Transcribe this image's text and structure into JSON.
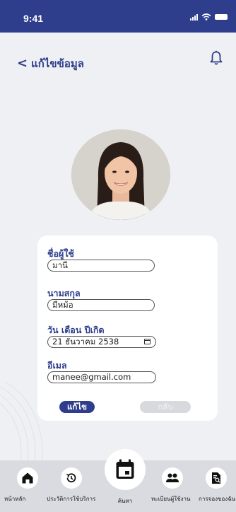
{
  "status_bar": {
    "time": "9:41"
  },
  "header": {
    "title": "แก้ไขข้อมูล",
    "back_chevron": "<"
  },
  "form": {
    "username_label": "ชื่อผู้ใช้",
    "username_value": "มานี",
    "lastname_label": "นามสกุล",
    "lastname_value": "มีหม้อ",
    "birthdate_label": "วัน เดือน ปีเกิด",
    "birthdate_value": "21 ธันวาคม 2538",
    "email_label": "อีเมล",
    "email_value": "manee@gmail.com",
    "edit_button": "แก้ไข",
    "back_button": "กลับ"
  },
  "bottom_nav": {
    "items": [
      {
        "label": "หน้าหลัก",
        "icon": "home-icon"
      },
      {
        "label": "ประวัติการใช้บริการ",
        "icon": "history-icon"
      },
      {
        "label": "ค้นหา",
        "icon": "calendar-icon"
      },
      {
        "label": "ทะเบียนผู้ใช้งาน",
        "icon": "users-icon"
      },
      {
        "label": "การจองของฉัน",
        "icon": "document-search-icon"
      }
    ]
  },
  "colors": {
    "primary": "#2e3d8c",
    "background": "#eef0f3",
    "nav_bar": "#d9dbe0",
    "disabled_button": "#d7d9dd"
  }
}
